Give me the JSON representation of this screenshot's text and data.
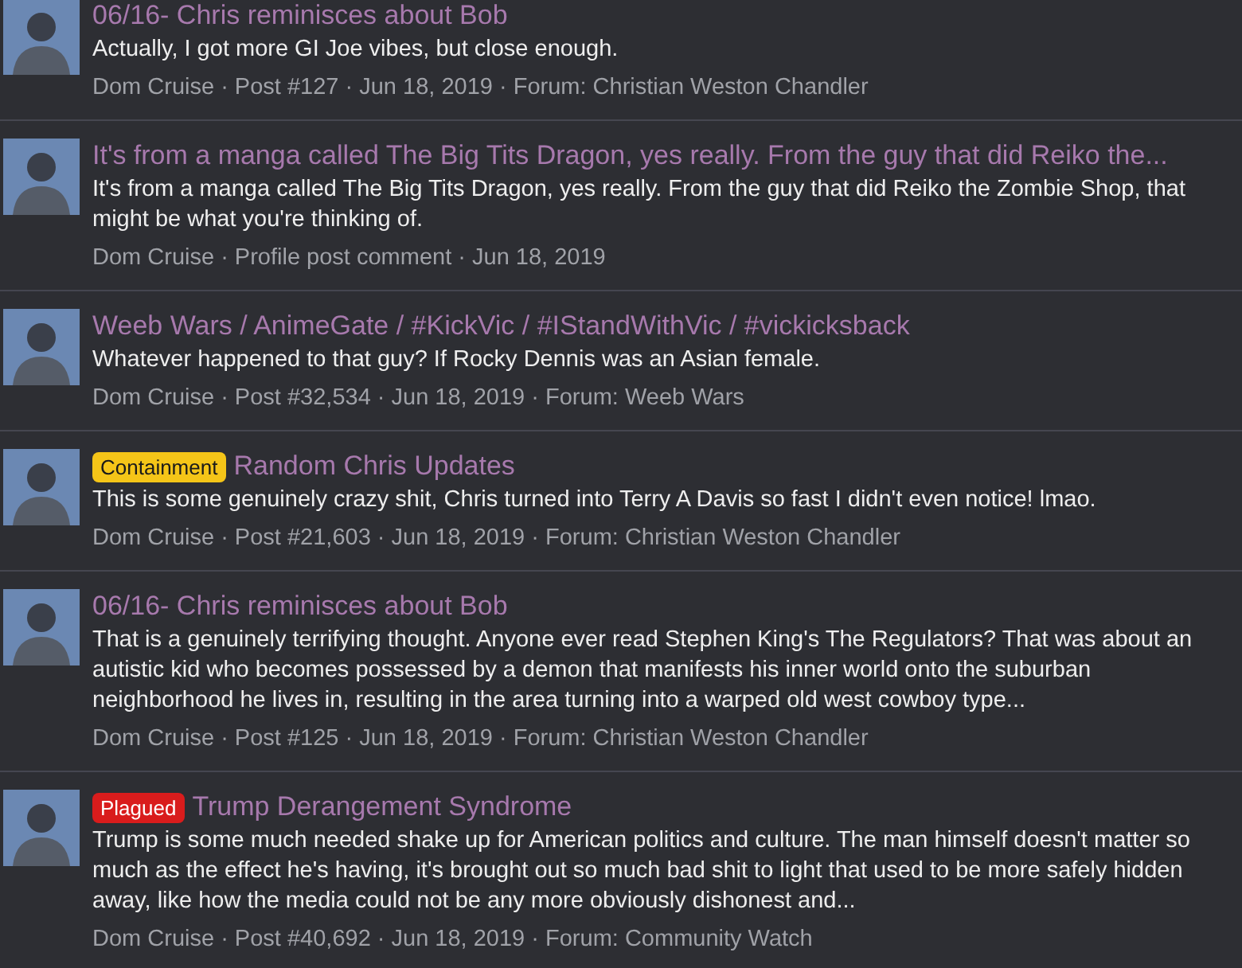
{
  "results": [
    {
      "title": "06/16- Chris reminisces about Bob",
      "body": "Actually, I got more GI Joe vibes, but close enough.",
      "meta": "Dom Cruise · Post #127 · Jun 18, 2019 · Forum: Christian Weston Chandler"
    },
    {
      "title": "It's from a manga called The Big Tits Dragon, yes really. From the guy that did Reiko the...",
      "body": "It's from a manga called The Big Tits Dragon, yes really. From the guy that did Reiko the Zombie Shop, that might be what you're thinking of.",
      "meta": "Dom Cruise · Profile post comment · Jun 18, 2019"
    },
    {
      "title": "Weeb Wars / AnimeGate / #KickVic / #IStandWithVic / #vickicksback",
      "body": "Whatever happened to that guy? If Rocky Dennis was an Asian female.",
      "meta": "Dom Cruise · Post #32,534 · Jun 18, 2019 · Forum: Weeb Wars"
    },
    {
      "prefix": {
        "label": "Containment",
        "color": "#f5c518"
      },
      "title": "Random Chris Updates",
      "body": "This is some genuinely crazy shit, Chris turned into Terry A Davis so fast I didn't even notice! lmao.",
      "meta": "Dom Cruise · Post #21,603 · Jun 18, 2019 · Forum: Christian Weston Chandler"
    },
    {
      "title": "06/16- Chris reminisces about Bob",
      "body": "That is a genuinely terrifying thought. Anyone ever read Stephen King's The Regulators? That was about an autistic kid who becomes possessed by a demon that manifests his inner world onto the suburban neighborhood he lives in, resulting in the area turning into a warped old west cowboy type...",
      "meta": "Dom Cruise · Post #125 · Jun 18, 2019 · Forum: Christian Weston Chandler"
    },
    {
      "prefix": {
        "label": "Plagued",
        "color": "#d91c1c"
      },
      "title": "Trump Derangement Syndrome",
      "body": "Trump is some much needed shake up for American politics and culture. The man himself doesn't matter so much as the effect he's having, it's brought out so much bad shit to light that used to be more safely hidden away, like how the media could not be any more obviously dishonest and...",
      "meta": "Dom Cruise · Post #40,692 · Jun 18, 2019 · Forum: Community Watch"
    }
  ]
}
